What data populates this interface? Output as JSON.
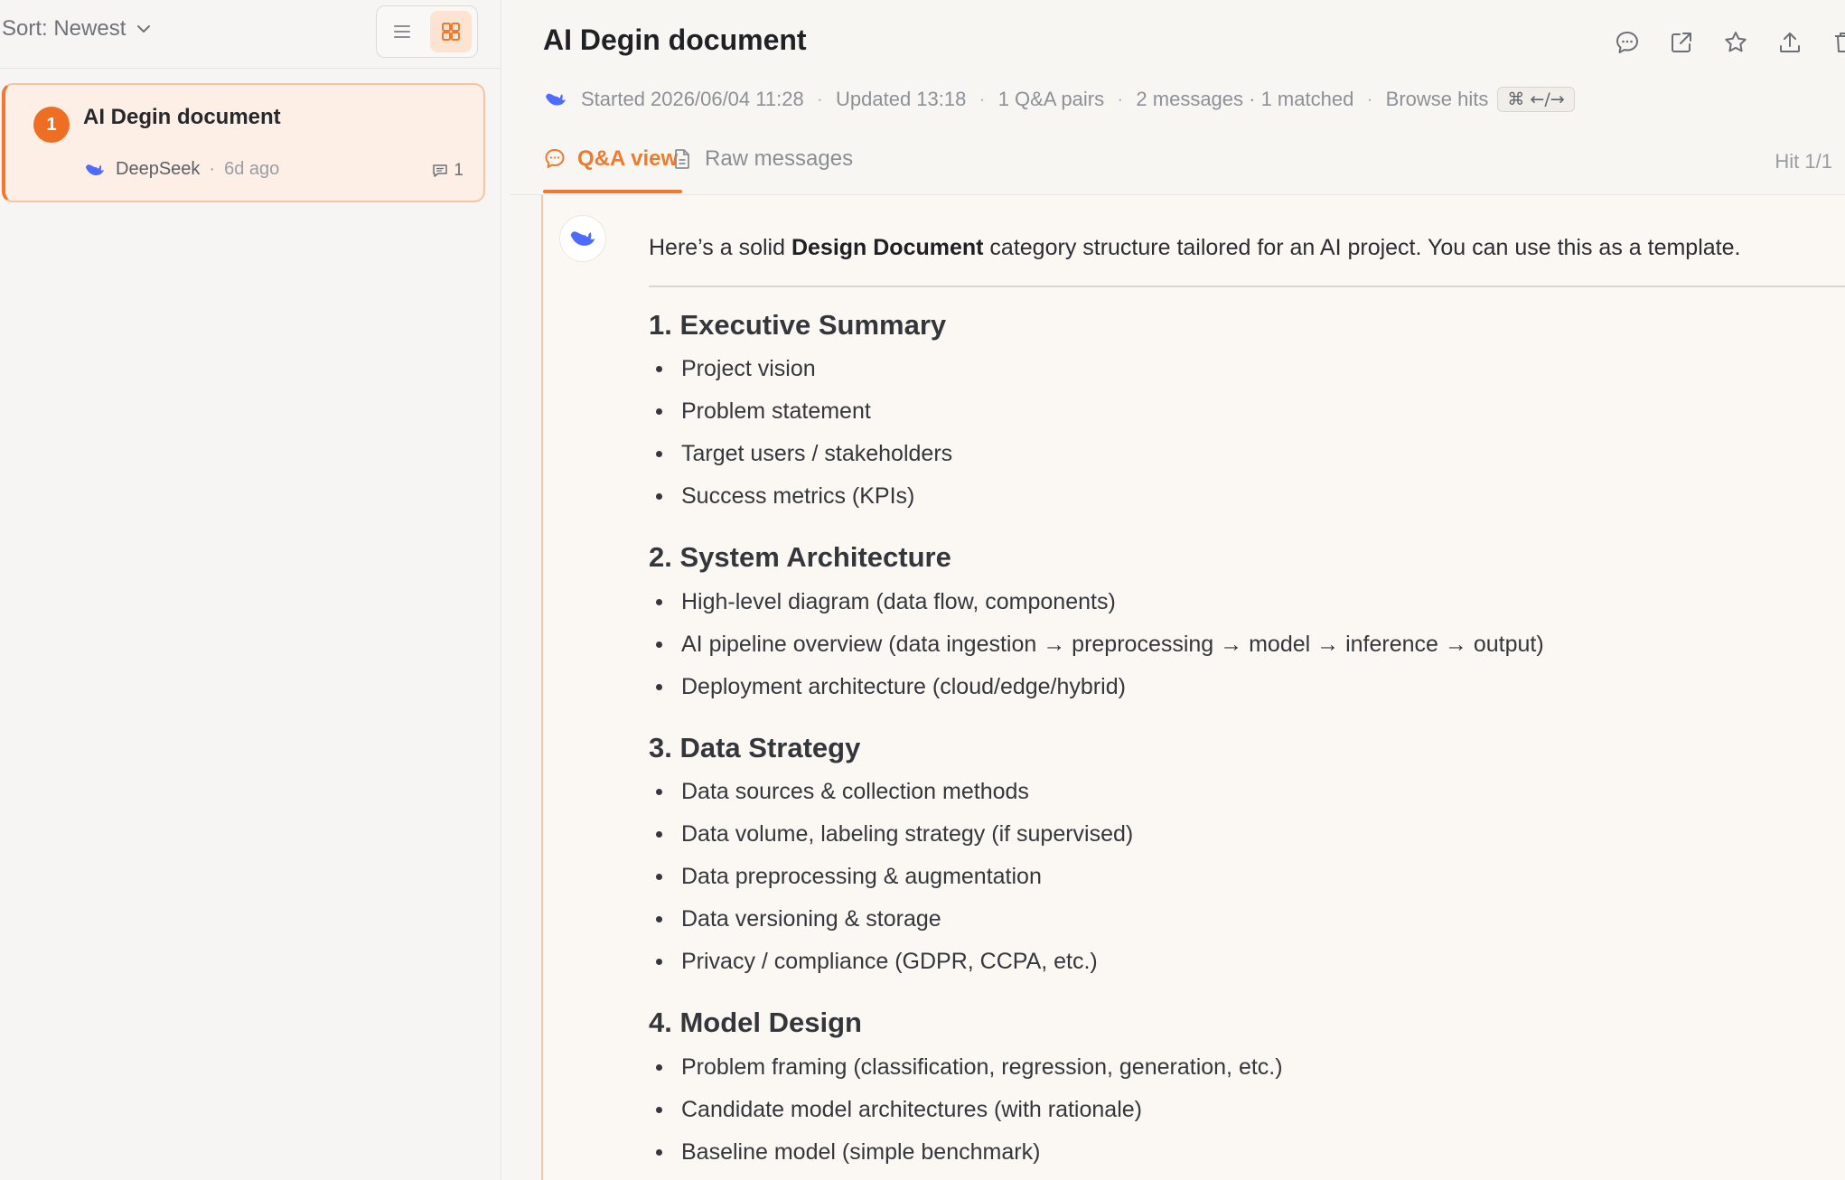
{
  "sidebar": {
    "sort_label": "Sort: Newest",
    "conversation": {
      "badge": "1",
      "title": "AI Degin document",
      "source": "DeepSeek",
      "age": "6d ago",
      "message_count": "1",
      "separator": "·"
    }
  },
  "header": {
    "title": "AI Degin document",
    "meta": {
      "started": "Started 2026/06/04 11:28",
      "updated": "Updated 13:18",
      "qa_pairs": "1 Q&A pairs",
      "messages": "2 messages · 1 matched",
      "browse_hits": "Browse hits",
      "shortcut": "⌘ ←/→",
      "separator": "·"
    }
  },
  "tabs": {
    "qa_view": "Q&A view",
    "raw_messages": "Raw messages",
    "hit_counter": "Hit 1/1"
  },
  "answer": {
    "intro_prefix": "Here’s a solid ",
    "intro_bold": "Design Document",
    "intro_suffix": " category structure tailored for an AI project. You can use this as a template.",
    "sections": [
      {
        "title": "1. Executive Summary",
        "items": [
          "Project vision",
          "Problem statement",
          "Target users / stakeholders",
          "Success metrics (KPIs)"
        ]
      },
      {
        "title": "2. System Architecture",
        "items": [
          "High-level diagram (data flow, components)",
          "AI pipeline overview (data ingestion → preprocessing → model → inference → output)",
          "Deployment architecture (cloud/edge/hybrid)"
        ]
      },
      {
        "title": "3. Data Strategy",
        "items": [
          "Data sources & collection methods",
          "Data volume, labeling strategy (if supervised)",
          "Data preprocessing & augmentation",
          "Data versioning & storage",
          "Privacy / compliance (GDPR, CCPA, etc.)"
        ]
      },
      {
        "title": "4. Model Design",
        "items": [
          "Problem framing (classification, regression, generation, etc.)",
          "Candidate model architectures (with rationale)",
          "Baseline model (simple benchmark)"
        ]
      }
    ]
  },
  "colors": {
    "accent": "#ec7a2f",
    "badge": "#ee6f23",
    "deepseek_blue": "#4d6bfe"
  },
  "icons": {
    "sort_chevron": "chevron-down-icon",
    "list_view": "list-view-icon",
    "grid_view": "grid-view-icon",
    "comment": "comment-icon",
    "open_external": "open-external-icon",
    "star": "star-icon",
    "upload": "upload-icon",
    "delete": "trash-icon",
    "deepseek": "deepseek-logo-icon",
    "raw_doc": "document-icon",
    "qa_chat": "chat-bubble-icon",
    "message_count": "message-count-icon"
  }
}
